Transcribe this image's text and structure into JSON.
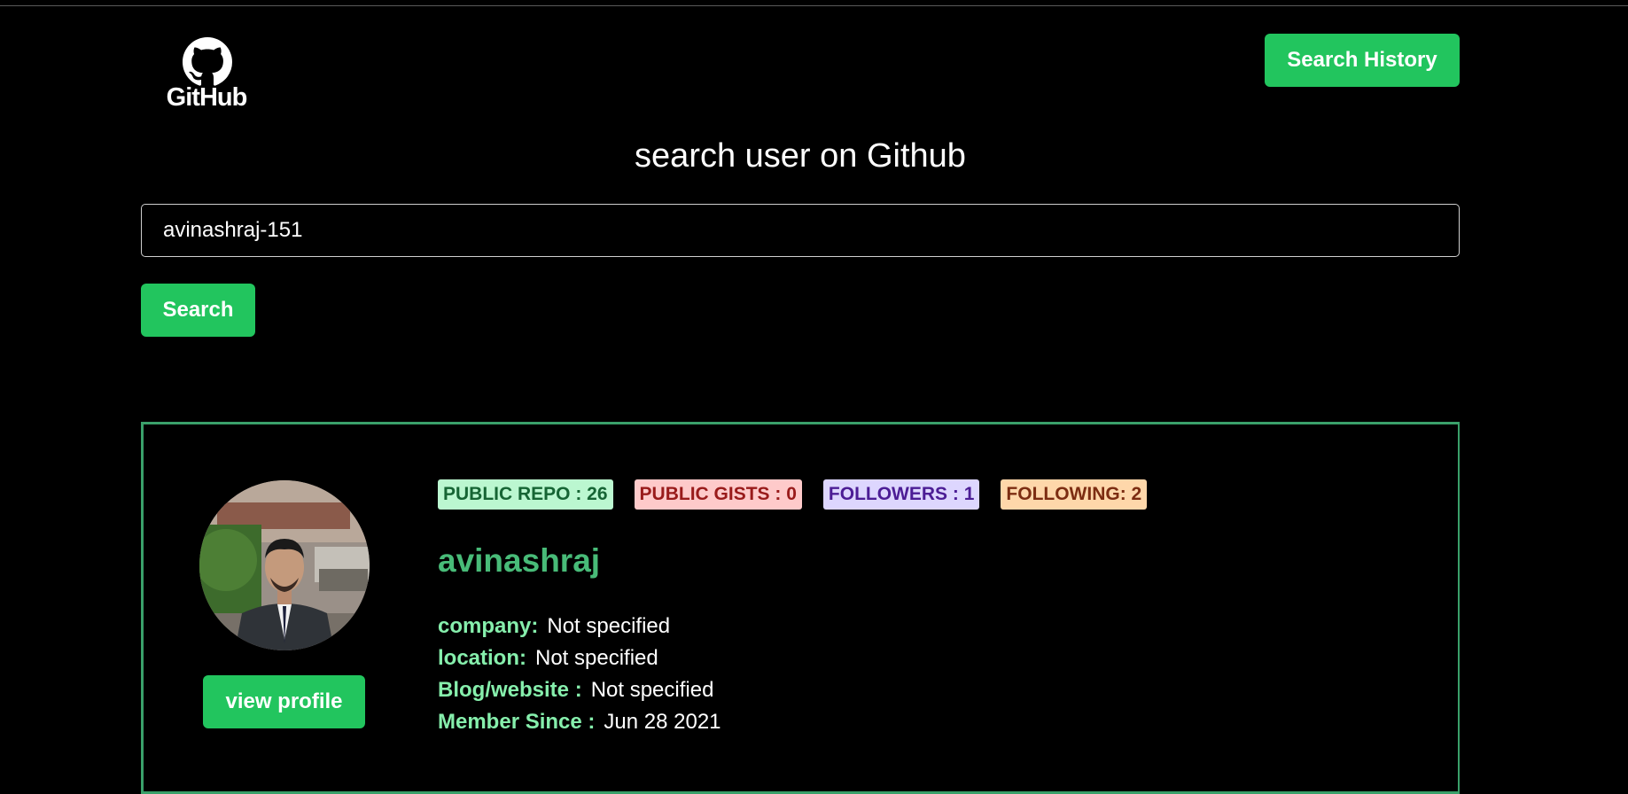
{
  "header": {
    "logo_text": "GitHub",
    "history_button": "Search History"
  },
  "search": {
    "heading": "search user on Github",
    "value": "avinashraj-151",
    "button": "Search"
  },
  "profile": {
    "badges": {
      "public_repo": "PUBLIC REPO : 26",
      "public_gists": "PUBLIC GISTS : 0",
      "followers": "FOLLOWERS : 1",
      "following": "FOLLOWING: 2"
    },
    "username": "avinashraj",
    "view_profile_button": "view profile",
    "details": [
      {
        "label": "company:",
        "value": "Not specified"
      },
      {
        "label": "location:",
        "value": "Not specified"
      },
      {
        "label": "Blog/website :",
        "value": "Not specified"
      },
      {
        "label": "Member Since :",
        "value": "Jun 28 2021"
      }
    ]
  },
  "colors": {
    "accent": "#22c55e",
    "username": "#48bb78",
    "card_border": "#3aa06a",
    "label": "#86efac"
  },
  "icons": {
    "logo": "github-logo-icon"
  }
}
